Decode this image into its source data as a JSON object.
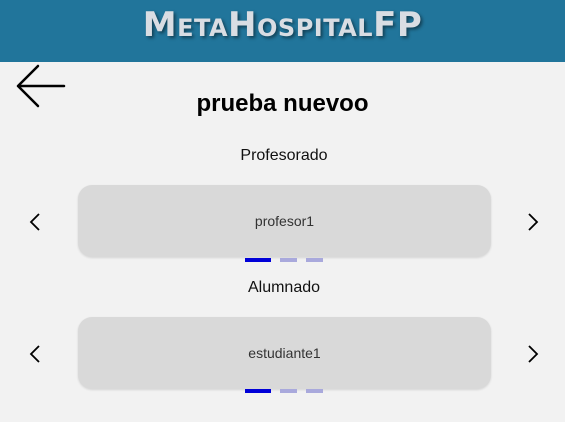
{
  "header": {
    "brand": "MetaHospitalFP"
  },
  "nav": {
    "back_icon": "arrow-left-icon"
  },
  "page": {
    "title": "prueba nuevoo"
  },
  "profesorado": {
    "label": "Profesorado",
    "current": "profesor1",
    "dots": [
      true,
      false,
      false
    ]
  },
  "alumnado": {
    "label": "Alumnado",
    "current": "estudiante1",
    "dots": [
      true,
      false,
      false
    ]
  },
  "colors": {
    "header_bg": "#21759b",
    "page_bg": "#f2f2f2",
    "card_bg": "#d9d9d9",
    "dot_active": "#0000d8",
    "dot_inactive": "#a9a9dc"
  }
}
